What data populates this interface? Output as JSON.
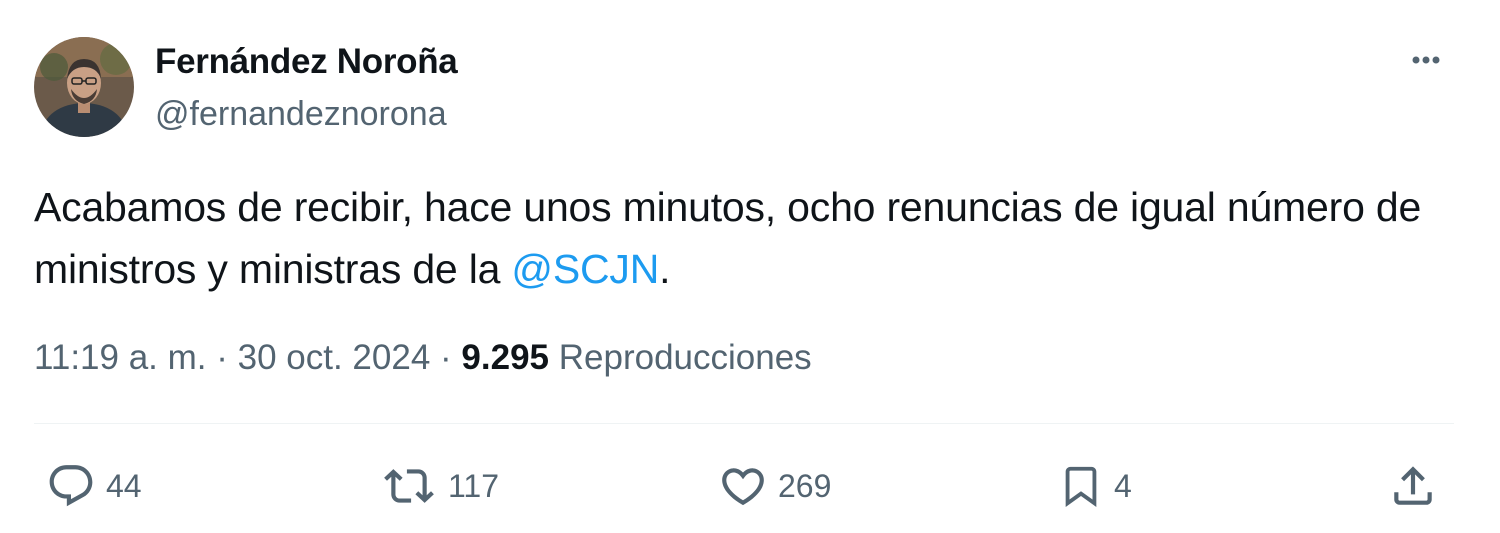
{
  "author": {
    "name": "Fernández Noroña",
    "handle": "@fernandeznorona",
    "avatar_icon": "profile-photo"
  },
  "tweet": {
    "text_before": "Acabamos de recibir, hace unos minutos, ocho renuncias de igual número de ministros y ministras de la ",
    "mention": "@SCJN",
    "text_after": ".",
    "time": "11:19 a. m.",
    "date": "30 oct. 2024",
    "views": "9.295",
    "views_label": "Reproducciones",
    "separator": "·"
  },
  "actions": {
    "reply": {
      "icon": "reply-icon",
      "count": "44"
    },
    "retweet": {
      "icon": "retweet-icon",
      "count": "117"
    },
    "like": {
      "icon": "heart-icon",
      "count": "269"
    },
    "bookmark": {
      "icon": "bookmark-icon",
      "count": "4"
    },
    "share": {
      "icon": "share-icon"
    }
  },
  "colors": {
    "text": "#0f1419",
    "secondary": "#536471",
    "link": "#1d9bf0",
    "divider": "#eff3f4"
  }
}
